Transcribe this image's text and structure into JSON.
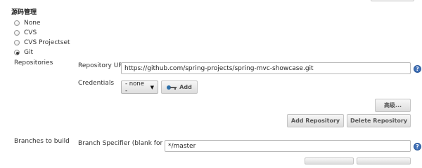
{
  "section_title": "源码管理",
  "scm_options": [
    {
      "label": "None",
      "selected": false
    },
    {
      "label": "CVS",
      "selected": false
    },
    {
      "label": "CVS Projectset",
      "selected": false
    },
    {
      "label": "Git",
      "selected": true
    }
  ],
  "repositories": {
    "label": "Repositories",
    "url_label": "Repository URL",
    "url_value": "https://github.com/spring-projects/spring-mvc-showcase.git",
    "credentials_label": "Credentials",
    "credentials_selected": "- none -",
    "add_label": "Add",
    "advanced_label": "高级...",
    "add_repository_label": "Add Repository",
    "delete_repository_label": "Delete Repository"
  },
  "branches": {
    "label": "Branches to build",
    "specifier_label": "Branch Specifier (blank for 'any')",
    "specifier_value": "*/master"
  },
  "help_glyph": "?",
  "caret_glyph": "▼"
}
